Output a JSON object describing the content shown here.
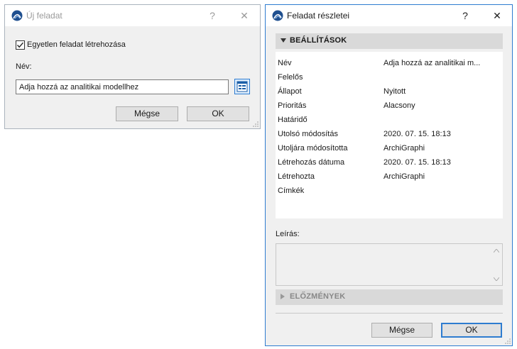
{
  "left_dialog": {
    "title": "Új feladat",
    "help_label": "?",
    "close_label": "✕",
    "checkbox_label": "Egyetlen feladat létrehozása",
    "name_label": "Név:",
    "name_value": "Adja hozzá az analitikai modellhez",
    "cancel_label": "Mégse",
    "ok_label": "OK"
  },
  "right_dialog": {
    "title": "Feladat részletei",
    "help_label": "?",
    "close_label": "✕",
    "settings_header": "BEÁLLÍTÁSOK",
    "properties": [
      {
        "key": "Név",
        "value": "Adja hozzá az analitikai m..."
      },
      {
        "key": "Felelős",
        "value": ""
      },
      {
        "key": "Állapot",
        "value": "Nyitott"
      },
      {
        "key": "Prioritás",
        "value": "Alacsony"
      },
      {
        "key": "Határidő",
        "value": ""
      },
      {
        "key": "Utolsó módosítás",
        "value": "2020. 07. 15. 18:13"
      },
      {
        "key": "Utoljára módosította",
        "value": "ArchiGraphi"
      },
      {
        "key": "Létrehozás dátuma",
        "value": "2020. 07. 15. 18:13"
      },
      {
        "key": "Létrehozta",
        "value": "ArchiGraphi"
      },
      {
        "key": "Címkék",
        "value": ""
      }
    ],
    "description_label": "Leírás:",
    "history_header": "ELŐZMÉNYEK",
    "cancel_label": "Mégse",
    "ok_label": "OK"
  },
  "colors": {
    "accent": "#2e7cd0",
    "logo": "#1f4f8f"
  },
  "icons": [
    "archicad-logo-icon",
    "help-icon",
    "close-icon",
    "checkbox-checked-icon",
    "name-picker-icon",
    "triangle-down-icon",
    "triangle-right-icon",
    "scroll-up-icon",
    "scroll-down-icon",
    "resize-grip-icon"
  ]
}
